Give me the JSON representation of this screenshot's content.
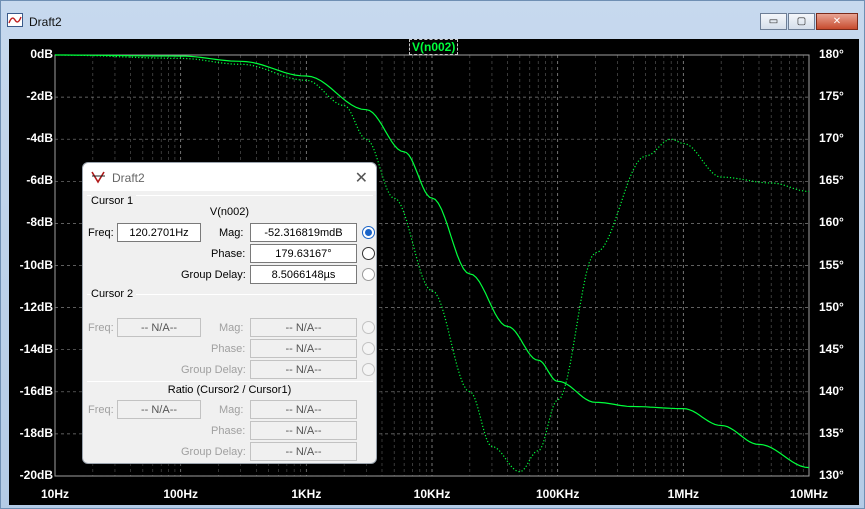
{
  "window": {
    "title": "Draft2",
    "buttons": {
      "minimize": "▭",
      "restore": "▢",
      "close": "✕"
    }
  },
  "plot": {
    "trace_label": "V(n002)",
    "colors": {
      "trace": "#00ff3c",
      "grid": "#a0a0a0",
      "background": "#000000"
    }
  },
  "chart_data": {
    "type": "line",
    "title": "",
    "x_scale": "log",
    "xlim": [
      10,
      10000000
    ],
    "x_ticks": [
      "10Hz",
      "100Hz",
      "1KHz",
      "10KHz",
      "100KHz",
      "1MHz",
      "10MHz"
    ],
    "ylim": [
      -20,
      0
    ],
    "y_ticks": [
      "0dB",
      "-2dB",
      "-4dB",
      "-6dB",
      "-8dB",
      "-10dB",
      "-12dB",
      "-14dB",
      "-16dB",
      "-18dB",
      "-20dB"
    ],
    "y2lim": [
      130,
      180
    ],
    "y2_ticks": [
      "180°",
      "175°",
      "170°",
      "165°",
      "160°",
      "155°",
      "150°",
      "145°",
      "140°",
      "135°",
      "130°"
    ],
    "grid": true,
    "series": [
      {
        "name": "V(n002)",
        "axis": "left",
        "style": "solid",
        "x": [
          10,
          100,
          300,
          1000,
          3000,
          6000,
          10000,
          20000,
          40000,
          70000,
          100000,
          200000,
          400000,
          1000000,
          2000000,
          4000000,
          10000000
        ],
        "values": [
          0,
          -0.05,
          -0.3,
          -1.0,
          -2.6,
          -4.6,
          -6.8,
          -10.4,
          -12.9,
          -14.5,
          -15.5,
          -16.5,
          -16.7,
          -16.8,
          -17.6,
          -18.5,
          -19.6
        ]
      },
      {
        "name": "V(n002) phase",
        "axis": "right",
        "style": "dotted",
        "x": [
          10,
          100,
          300,
          1000,
          2000,
          3000,
          5000,
          10000,
          20000,
          30000,
          50000,
          70000,
          100000,
          200000,
          500000,
          800000,
          1000000,
          2000000,
          5000000,
          10000000
        ],
        "values": [
          180,
          179.6,
          178.9,
          177.0,
          174.0,
          170.0,
          163.0,
          152.0,
          140.0,
          133.5,
          130.5,
          133.0,
          139.0,
          156.5,
          168.0,
          170.0,
          169.5,
          165.5,
          164.8,
          163.8
        ]
      }
    ]
  },
  "dialog": {
    "title": "Draft2",
    "close": "✕",
    "cursor1": {
      "heading": "Cursor 1",
      "trace": "V(n002)",
      "freq_label": "Freq:",
      "freq": "120.2701Hz",
      "mag_label": "Mag:",
      "mag": "-52.316819mdB",
      "phase_label": "Phase:",
      "phase": "179.63167°",
      "delay_label": "Group Delay:",
      "delay": "8.5066148µs",
      "selected": "mag"
    },
    "cursor2": {
      "heading": "Cursor 2",
      "freq_label": "Freq:",
      "freq": "-- N/A--",
      "mag_label": "Mag:",
      "mag": "-- N/A--",
      "phase_label": "Phase:",
      "phase": "-- N/A--",
      "delay_label": "Group Delay:",
      "delay": "-- N/A--"
    },
    "ratio": {
      "heading": "Ratio (Cursor2 / Cursor1)",
      "freq_label": "Freq:",
      "freq": "-- N/A--",
      "mag_label": "Mag:",
      "mag": "-- N/A--",
      "phase_label": "Phase:",
      "phase": "-- N/A--",
      "delay_label": "Group Delay:",
      "delay": "-- N/A--"
    }
  }
}
